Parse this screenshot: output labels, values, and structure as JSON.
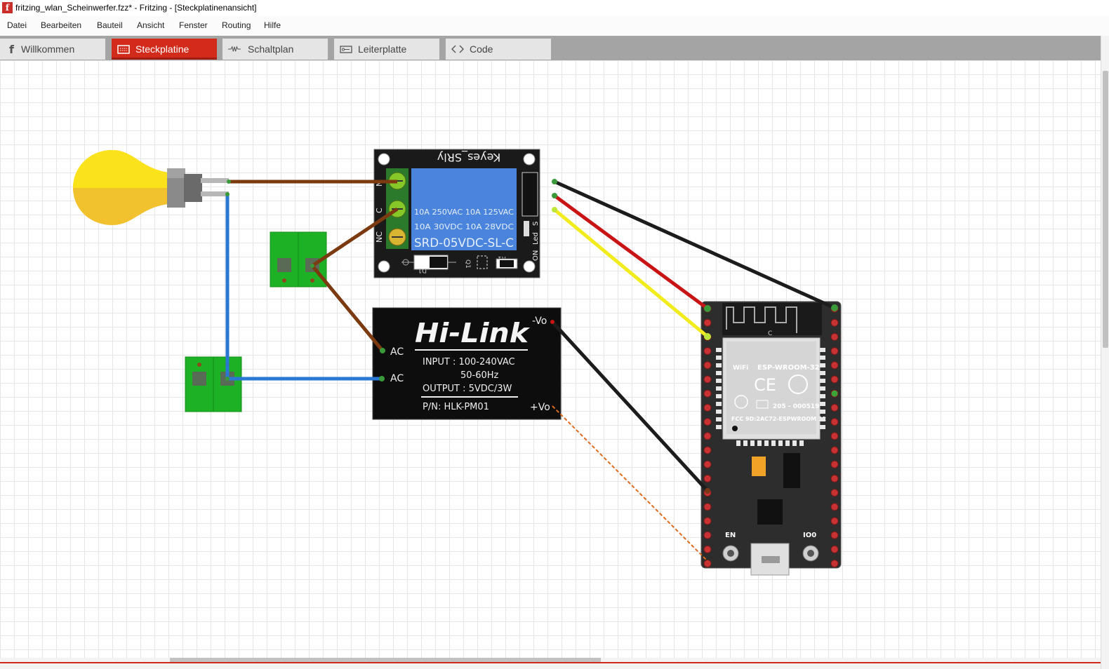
{
  "window": {
    "title": "fritzing_wlan_Scheinwerfer.fzz* - Fritzing - [Steckplatinenansicht]",
    "app_icon": "f"
  },
  "menu": [
    "Datei",
    "Bearbeiten",
    "Bauteil",
    "Ansicht",
    "Fenster",
    "Routing",
    "Hilfe"
  ],
  "tabs": [
    {
      "label": "Willkommen",
      "icon": "fritzing-f-icon",
      "active": false
    },
    {
      "label": "Steckplatine",
      "icon": "breadboard-icon",
      "active": true
    },
    {
      "label": "Schaltplan",
      "icon": "resistor-icon",
      "active": false
    },
    {
      "label": "Leiterplatte",
      "icon": "pcb-icon",
      "active": false
    },
    {
      "label": "Code",
      "icon": "code-icon",
      "active": false
    }
  ],
  "relay": {
    "brand": "Keyes_SRly",
    "pins_left": [
      "N",
      "C",
      "NC"
    ],
    "rating_line1": "10A 250VAC  10A 125VAC",
    "rating_line2": "10A  30VDC  10A  28VDC",
    "model": "SRD-05VDC-SL-C",
    "labels_right": [
      "ON",
      "Led",
      "S"
    ],
    "components": [
      "D1",
      "Q1",
      "R1"
    ]
  },
  "hilink": {
    "logo": "Hi-Link",
    "input": "INPUT : 100-240VAC",
    "freq": "50-60Hz",
    "output": "OUTPUT : 5VDC/3W",
    "pn": "P/N: HLK-PM01",
    "pin_ac1": "AC",
    "pin_ac2": "AC",
    "pin_vneg": "-Vo",
    "pin_vpos": "+Vo"
  },
  "esp32": {
    "module": "ESP-WROOM-32",
    "wifi": "WiFi",
    "ce": "CE",
    "r_code": "205 - 000519",
    "fcc": "FCC 9D:2AC72-ESPWROOM 32",
    "btn_en": "EN",
    "btn_io0": "IO0",
    "antenna_c": "C"
  },
  "logo": "fritzing",
  "colors": {
    "accent": "#d22b1c",
    "wire_brown": "#7b3a10",
    "wire_blue": "#2a77d4",
    "wire_black": "#1c1c1c",
    "wire_red": "#c81414",
    "wire_yellow": "#f2ec1c",
    "ratsnest": "#e06a1c",
    "terminal_green": "#14b11e"
  }
}
